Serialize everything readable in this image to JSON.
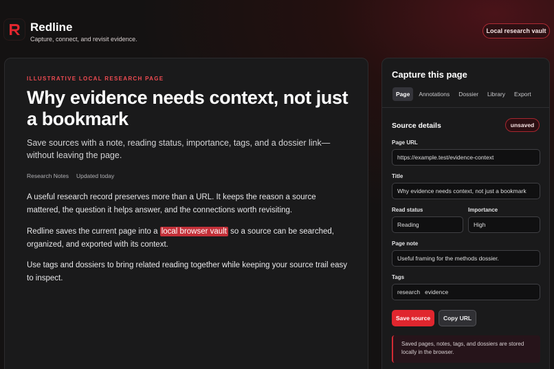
{
  "header": {
    "brand": "Redline",
    "tagline": "Capture, connect, and revisit evidence.",
    "vault_button": "Local research vault"
  },
  "article": {
    "eyebrow": "ILLUSTRATIVE LOCAL RESEARCH PAGE",
    "title": "Why evidence needs context, not just a bookmark",
    "subtitle": "Save sources with a note, reading status, importance, tags, and a dossier link—without leaving the page.",
    "meta_category": "Research Notes",
    "meta_updated": "Updated today",
    "p1": "A useful research record preserves more than a URL. It keeps the reason a source mattered, the question it helps answer, and the connections worth revisiting.",
    "p2_before": "Redline saves the current page into a ",
    "p2_highlight": "local browser vault",
    "p2_after": " so a source can be searched, organized, and exported with its context.",
    "p3": "Use tags and dossiers to bring related reading together while keeping your source trail easy to inspect."
  },
  "panel": {
    "title": "Capture this page",
    "tabs": [
      "Page",
      "Annotations",
      "Dossier",
      "Library",
      "Export"
    ],
    "active_tab": "Page",
    "section_title": "Source details",
    "status_badge": "unsaved",
    "url_label": "Page URL",
    "url_value": "https://example.test/evidence-context",
    "title_label": "Title",
    "title_value": "Why evidence needs context, not just a bookmark",
    "status_label": "Read status",
    "status_value": "Reading",
    "importance_label": "Importance",
    "importance_value": "High",
    "note_label": "Page note",
    "note_value": "Useful framing for the methods dossier.",
    "tags_label": "Tags",
    "tags_value": "research   evidence",
    "save_button": "Save source",
    "copy_button": "Copy URL",
    "notice": "Saved pages, notes, tags, and dossiers are stored locally in the browser."
  },
  "colors": {
    "accent": "#e0262e",
    "highlight": "#c43039",
    "eyebrow": "#ef4b52"
  },
  "icons": {
    "logo": "redline-r-logo-icon"
  }
}
